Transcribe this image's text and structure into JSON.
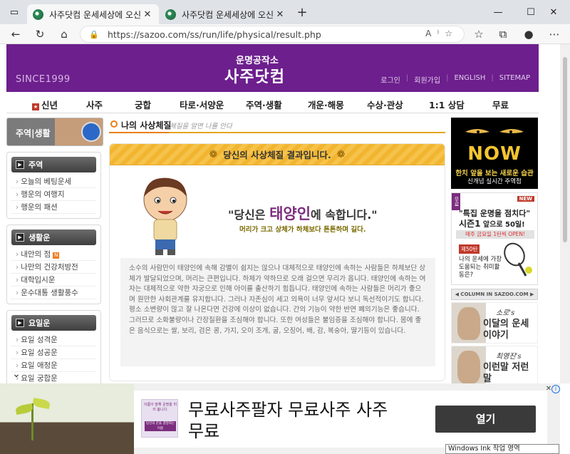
{
  "browser": {
    "tabs": [
      {
        "title": "사주닷컴 운세세상에 오신것을 환"
      },
      {
        "title": "사주닷컴 운세세상에 오신것을 환"
      }
    ],
    "url": "https://sazoo.com/ss/run/life/physical/result.php"
  },
  "header": {
    "since": "SINCE1999",
    "logo_sub": "운명공작소",
    "logo_main": "사주닷컴",
    "links": [
      "로그인",
      "회원가입",
      "ENGLISH",
      "SITEMAP"
    ]
  },
  "gnb": {
    "items": [
      "신년",
      "사주",
      "궁합",
      "타로·서양운",
      "주역·생활",
      "개운·해몽",
      "수상·관상",
      "1:1 상담",
      "무료"
    ]
  },
  "left": {
    "banner": "주역|생활",
    "sections": [
      {
        "title": "주역",
        "items": [
          "오늘의 베팅운세",
          "행운의 여행지",
          "행운의 패션"
        ]
      },
      {
        "title": "생활운",
        "items": [
          "내안의 점",
          "나만의 건강처방전",
          "대학입시운",
          "운수대통 생활풍수"
        ],
        "new_badge": "N"
      },
      {
        "title": "요일운",
        "items": [
          "요일 성격운",
          "요일 성공운",
          "요일 애정운",
          "요일 궁합운"
        ]
      }
    ]
  },
  "center": {
    "section_title": "나의 사상체질",
    "section_sub": "체질을 알면 나를 안다",
    "result_head": "당신의 사상체질 결과입니다.",
    "quote_pre": "\"당신은 ",
    "quote_hl": "태양인",
    "quote_post": "에 속합니다.\"",
    "quote_sub": "머리가 크고 상체가 하체보다 튼튼하며 길다.",
    "desc": "소수의 사람만이 태양인에 속해 감별이 쉽지는 않으나 대체적으로 태양인에 속하는 사람들은 하체보단 상체가 발달되었으며, 머리는 큰편입니다. 하체가 약하므로 오래 걸으면 무리가 옵니다. 태양인에 속하는 여자는 대체적으로 약한 자궁으로 인해 아이를 출산하기 힘듭니다. 태양인에 속하는 사람들은 머리가 좋으며 원만한 사회관계를 유지합니다. 그러나 자존심이 세고 의욕이 너무 앞서다 보니 독선적이기도 합니다. 평소 소변량이 많고 잘 나온다면 건강에 이상이 없습니다. 간의 기능이 약한 반면 폐의기능은 좋습니다. 그러므로 소화불량이나 간장질환을 조심해야 합니다. 또한 여성들은 불임증을 조심해야 합니다. 몸에 좋은 음식으로는 쌀, 보리, 검은 콩, 가지, 오이 조개, 굴, 오징어, 배, 감, 복숭아, 딸기등이 있습니다."
  },
  "right": {
    "now_banner": {
      "big": "NOW",
      "line1": "한치 앞을 보는 새로운 습관",
      "line2": "신개념 실시간 주역점"
    },
    "mag_banner": {
      "side": "무료",
      "new": "NEW",
      "h1": "\"특집 운명을 점치다\"",
      "h2": "시즌1",
      "h2_small": " 앞으로 50일!",
      "bar": "매주 금요일 1탄씩 OPEN!",
      "ep": "제50탄",
      "q": "나의 운세에 가장 도움되는 취미활동은?"
    },
    "column_head": "◀ COLUMN IN SAZOO.COM ▶",
    "columns": [
      {
        "sig": "소로's",
        "title": "이달의 운세이야기"
      },
      {
        "sig": "최영진's",
        "title": "이런말 저런말"
      }
    ]
  },
  "ad": {
    "title": "무료사주팔자 무료사주 사주무료",
    "button": "열기",
    "thumb_top": "이름이 말해 운명을 미리 봅니다.",
    "thumb_mid": "당신의 운을 결정하는 이름"
  },
  "overlay": {
    "ink": "Windows Ink 작업 영역"
  }
}
